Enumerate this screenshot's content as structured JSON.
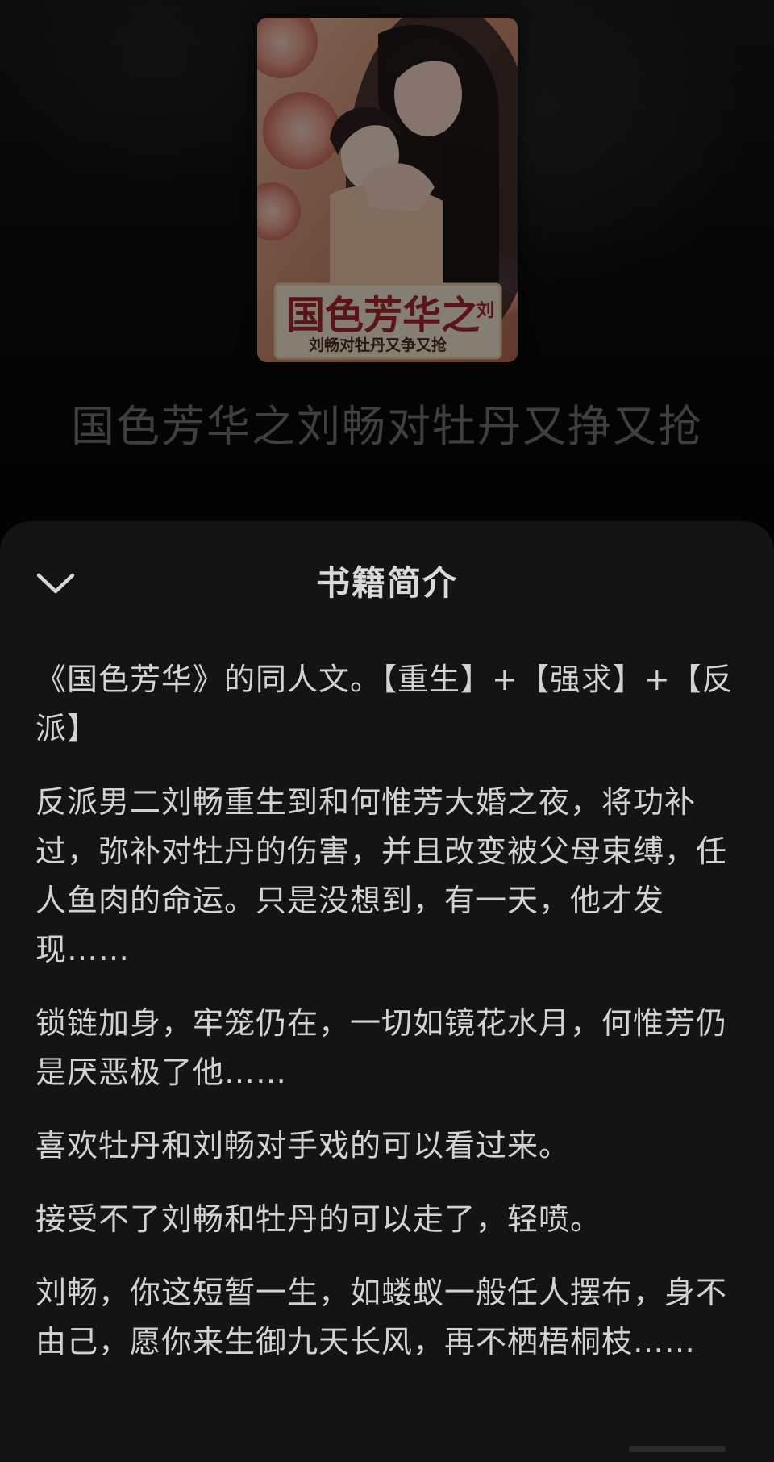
{
  "book": {
    "title": "国色芳华之刘畅对牡丹又挣又抢",
    "cover": {
      "title_text": "国色芳华之",
      "title_suffix": "刘",
      "subtitle_text": "刘畅对牡丹又争又抢"
    }
  },
  "sheet": {
    "title": "书籍简介",
    "collapse_icon": "chevron-down-icon",
    "paragraphs": [
      "《国色芳华》的同人文。【重生】+【强求】+【反派】",
      "反派男二刘畅重生到和何惟芳大婚之夜，将功补过，弥补对牡丹的伤害，并且改变被父母束缚，任人鱼肉的命运。只是没想到，有一天，他才发现……",
      "锁链加身，牢笼仍在，一切如镜花水月，何惟芳仍是厌恶极了他……",
      "喜欢牡丹和刘畅对手戏的可以看过来。",
      "接受不了刘畅和牡丹的可以走了，轻喷。",
      "刘畅，你这短暂一生，如蝼蚁一般任人摆布，身不由己，愿你来生御九天长风，再不栖梧桐枝……"
    ]
  },
  "colors": {
    "background": "#050505",
    "sheet": "#141414",
    "text": "#d2d2d2",
    "title_dim": "#3f3f3f"
  }
}
